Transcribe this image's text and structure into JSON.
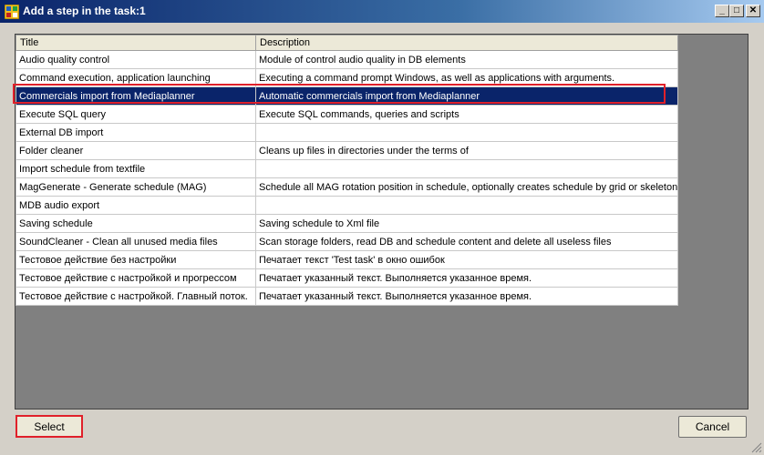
{
  "window": {
    "title": "Add a step in the task:1",
    "minimize_label": "_",
    "maximize_label": "□",
    "close_label": "✕"
  },
  "grid": {
    "columns": [
      "Title",
      "Description"
    ],
    "rows": [
      {
        "title": "Audio quality control",
        "description": "Module of control audio quality in DB elements"
      },
      {
        "title": "Command execution, application launching",
        "description": "Executing a command prompt Windows, as well as applications with arguments."
      },
      {
        "title": "Commercials import from Mediaplanner",
        "description": "Automatic commercials import from Mediaplanner",
        "selected": true
      },
      {
        "title": "Execute SQL query",
        "description": "Execute SQL commands, queries and scripts"
      },
      {
        "title": "External DB import",
        "description": ""
      },
      {
        "title": "Folder cleaner",
        "description": "Cleans up files in directories under the terms of"
      },
      {
        "title": "Import schedule from textfile",
        "description": ""
      },
      {
        "title": "MagGenerate - Generate schedule (MAG)",
        "description": "Schedule all MAG rotation position in schedule, optionally creates schedule by grid or skeleton"
      },
      {
        "title": "MDB audio export",
        "description": ""
      },
      {
        "title": "Saving schedule",
        "description": "Saving schedule to Xml file"
      },
      {
        "title": "SoundCleaner - Clean all unused media files",
        "description": "Scan storage folders, read DB and schedule content and delete all useless files"
      },
      {
        "title": "Тестовое действие без настройки",
        "description": "Печатает текст 'Test task' в окно ошибок"
      },
      {
        "title": "Тестовое действие с настройкой и прогрессом",
        "description": "Печатает указанный текст. Выполняется указанное время."
      },
      {
        "title": "Тестовое действие с настройкой. Главный поток.",
        "description": "Печатает указанный текст. Выполняется указанное время."
      }
    ]
  },
  "buttons": {
    "select_label": "Select",
    "cancel_label": "Cancel"
  },
  "colors": {
    "selection": "#0a246a",
    "highlight_outline": "#e0202a"
  }
}
